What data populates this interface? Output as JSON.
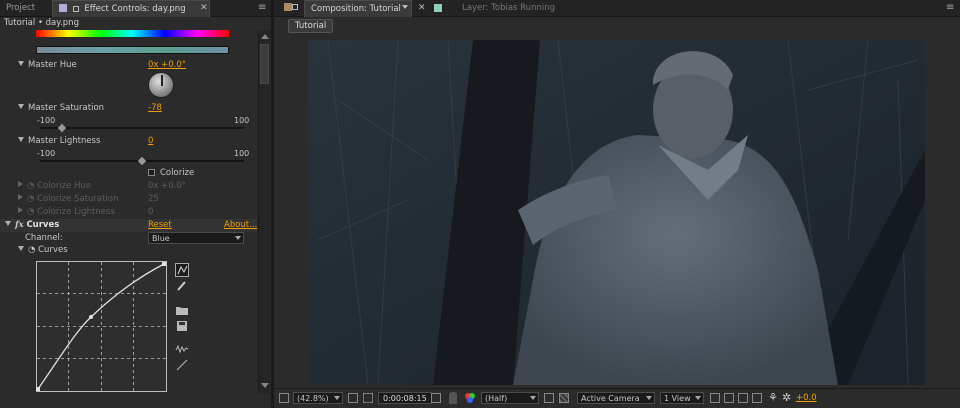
{
  "left_tabs": {
    "project": "Project",
    "effect_controls": "Effect Controls: day.png"
  },
  "left_subtitle": "Tutorial • day.png",
  "hue_sat": {
    "master_hue": {
      "label": "Master Hue",
      "value": "0x +0.0°"
    },
    "master_saturation": {
      "label": "Master Saturation",
      "value": "-78",
      "min": "-100",
      "max": "100",
      "level": 0.11
    },
    "master_lightness": {
      "label": "Master Lightness",
      "value": "0",
      "min": "-100",
      "max": "100",
      "level": 0.5
    },
    "colorize": {
      "label": "Colorize",
      "checked": false
    },
    "colorize_hue": {
      "label": "Colorize Hue",
      "value": "0x +0.0°"
    },
    "colorize_saturation": {
      "label": "Colorize Saturation",
      "value": "25"
    },
    "colorize_lightness": {
      "label": "Colorize Lightness",
      "value": "0"
    }
  },
  "curves": {
    "fx": "fx",
    "title": "Curves",
    "reset": "Reset",
    "about": "About...",
    "channel_label": "Channel:",
    "channel_value": "Blue",
    "curves_label": "Curves"
  },
  "right_tabs": {
    "composition": "Composition: Tutorial",
    "layer": "Layer: Tobias Running"
  },
  "comp_button": "Tutorial",
  "viewer_bar": {
    "zoom": "(42.8%)",
    "timecode": "0:00:08:15",
    "resolution": "(Half)",
    "camera": "Active Camera",
    "views": "1 View",
    "exposure": "+0.0"
  },
  "colors": {
    "accent_orange": "#f0a000",
    "panel_bg": "#2b2b2b",
    "viewer_bg": "#232a33"
  }
}
